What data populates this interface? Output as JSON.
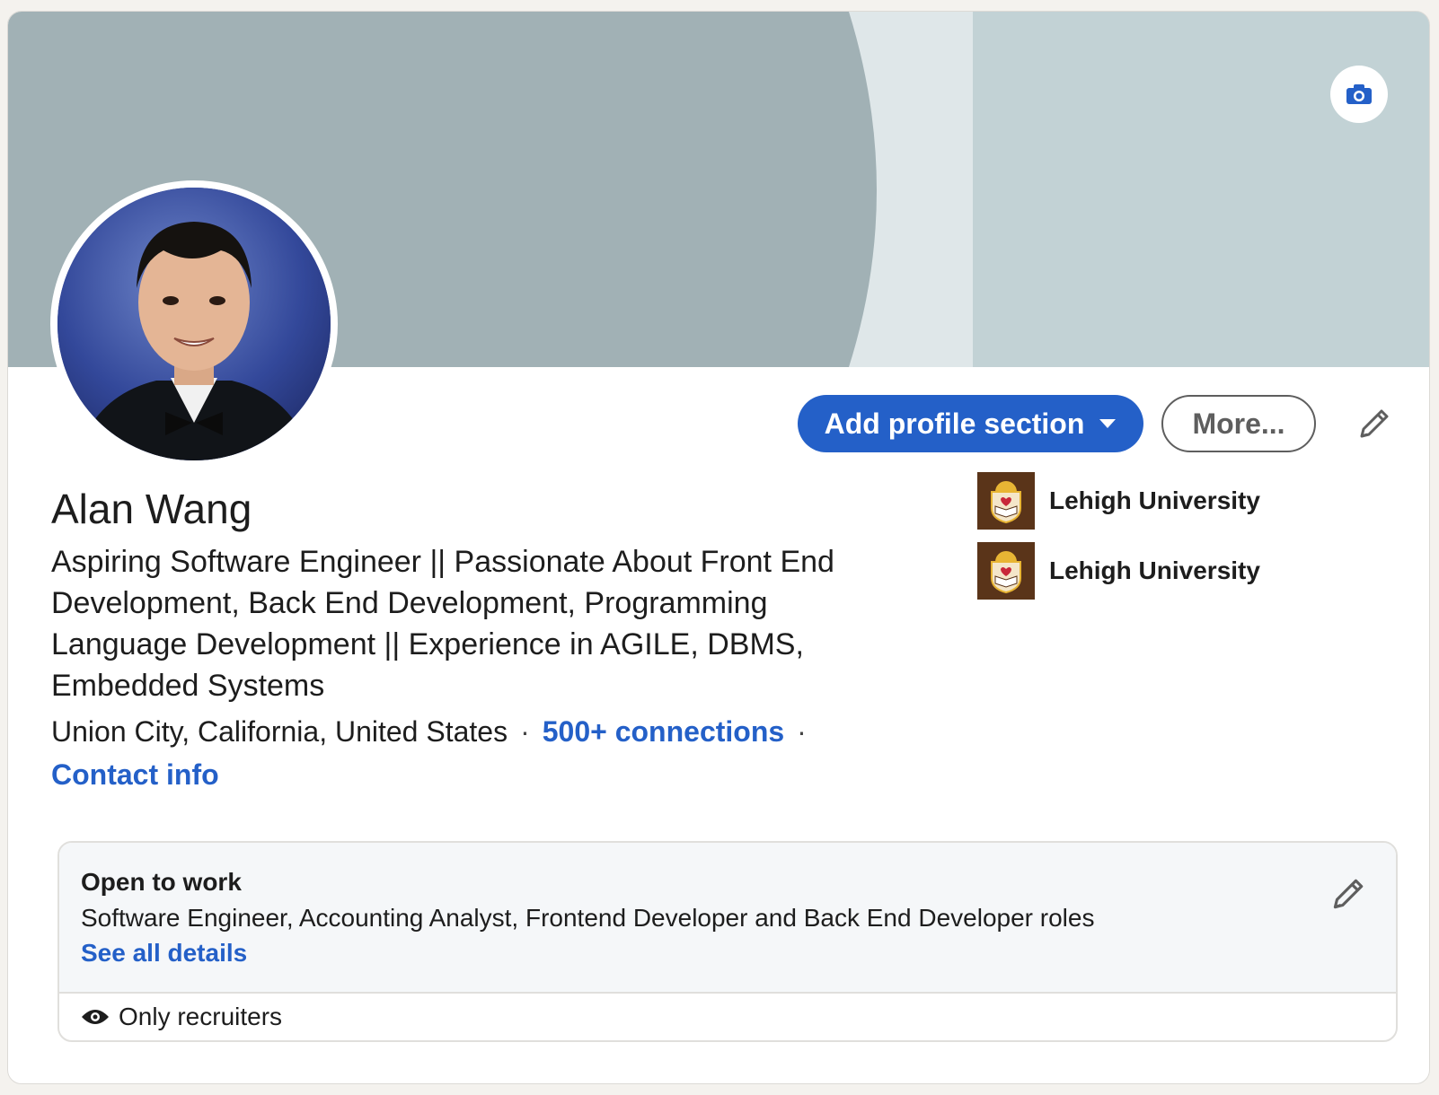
{
  "profile": {
    "name": "Alan Wang",
    "headline": "Aspiring Software Engineer || Passionate About Front End Development, Back End Development, Programming Language Development || Experience in AGILE, DBMS, Embedded Systems",
    "location": "Union City, California, United States",
    "connections": "500+ connections",
    "contact_info": "Contact info"
  },
  "actions": {
    "add_section": "Add profile section",
    "more": "More..."
  },
  "education": [
    {
      "label": "Lehigh University",
      "logo_icon": "lehigh-university-logo"
    },
    {
      "label": "Lehigh University",
      "logo_icon": "lehigh-university-logo"
    }
  ],
  "open_to_work": {
    "title": "Open to work",
    "roles": "Software Engineer, Accounting Analyst, Frontend Developer and Back End Developer roles",
    "details_link": "See all details",
    "visibility": "Only recruiters"
  },
  "icons": {
    "camera": "camera-icon",
    "pencil": "pencil-icon",
    "dropdown": "caret-down-icon",
    "eye": "eye-icon"
  },
  "colors": {
    "accent": "#2460c8",
    "banner_dark": "#a1b1b5",
    "banner_light": "#dfe7e9",
    "banner_mid": "#c2d2d5",
    "lehigh_brown": "#5a3419"
  }
}
